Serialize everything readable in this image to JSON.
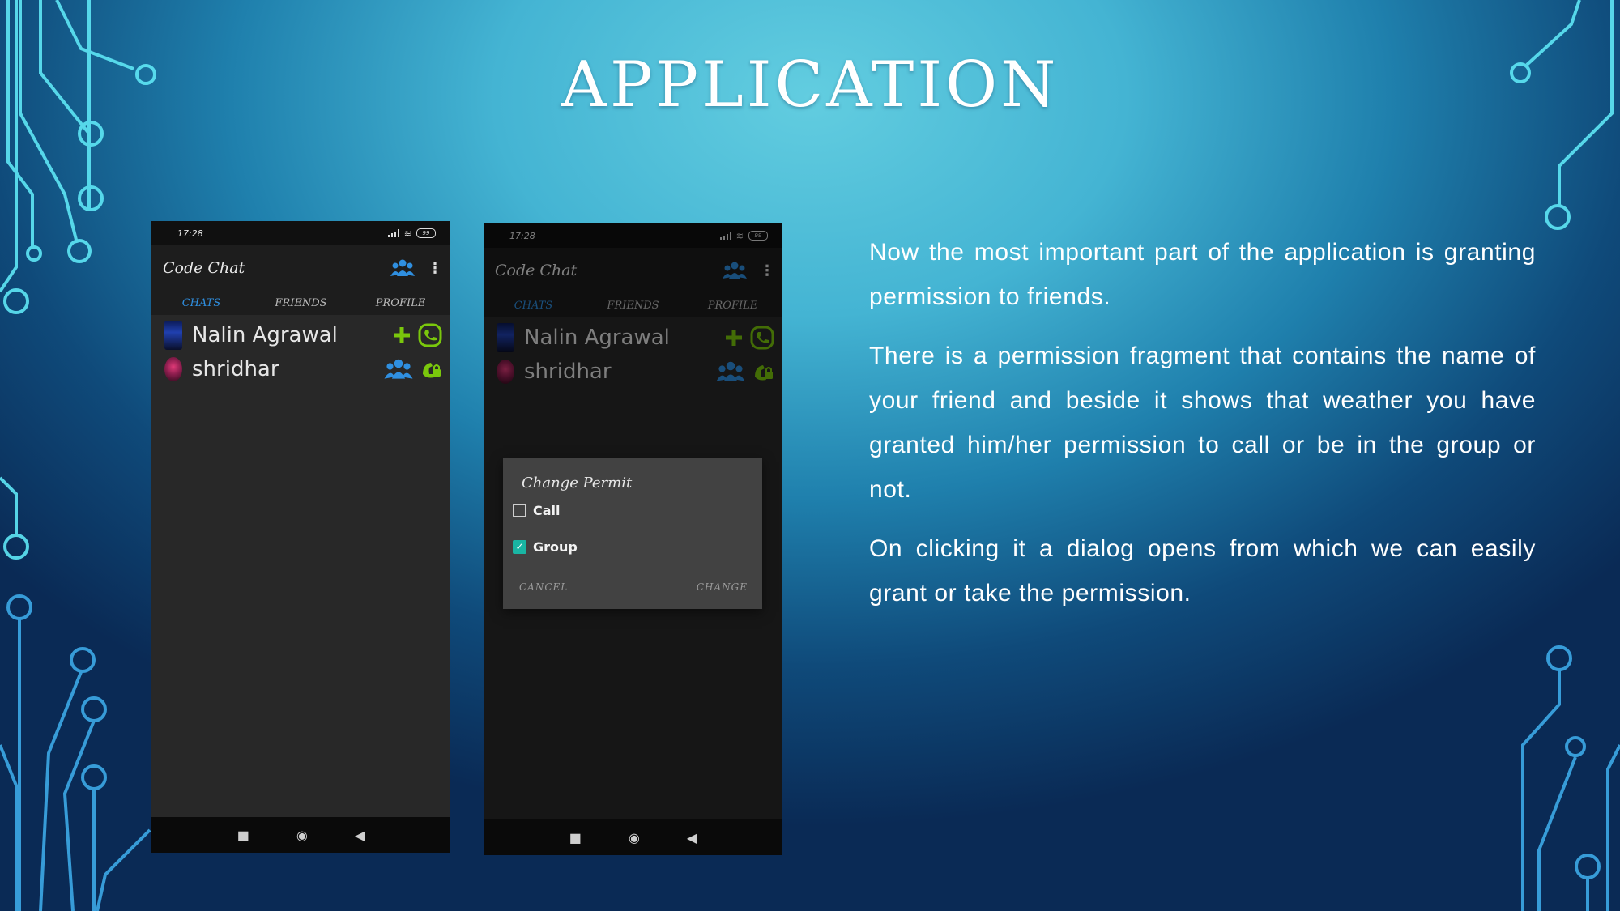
{
  "slide": {
    "title": "APPLICATION",
    "paragraphs": [
      "Now the most important part of the application is granting permission to friends.",
      "There is a permission fragment that contains the name of your friend and beside it shows that weather you have granted him/her permission to call or be in the group or not.",
      "On clicking it a dialog opens from which we can easily grant or take the permission."
    ]
  },
  "colors": {
    "accent_tab": "#2f8fe0",
    "icon_green": "#7ac70c",
    "icon_blue": "#2f8fe0",
    "checkbox_teal": "#19b5a3"
  },
  "phones": [
    {
      "status_time": "17:28",
      "battery": "99",
      "app_title": "Code Chat",
      "tabs": [
        "CHATS",
        "FRIENDS",
        "PROFILE"
      ],
      "contacts": [
        {
          "name": "Nalin Agrawal",
          "icons": [
            "plus-icon",
            "phone-permitted-icon"
          ]
        },
        {
          "name": "shridhar",
          "icons": [
            "group-icon",
            "phone-locked-icon"
          ]
        }
      ]
    },
    {
      "status_time": "17:28",
      "battery": "99",
      "app_title": "Code Chat",
      "tabs": [
        "CHATS",
        "FRIENDS",
        "PROFILE"
      ],
      "contacts": [
        {
          "name": "Nalin Agrawal",
          "icons": [
            "plus-icon",
            "phone-permitted-icon"
          ]
        },
        {
          "name": "shridhar",
          "icons": [
            "group-icon",
            "phone-locked-icon"
          ]
        }
      ],
      "dialog": {
        "title": "Change Permit",
        "options": [
          {
            "label": "Call",
            "checked": false
          },
          {
            "label": "Group",
            "checked": true
          }
        ],
        "cancel_label": "CANCEL",
        "confirm_label": "CHANGE"
      }
    }
  ]
}
